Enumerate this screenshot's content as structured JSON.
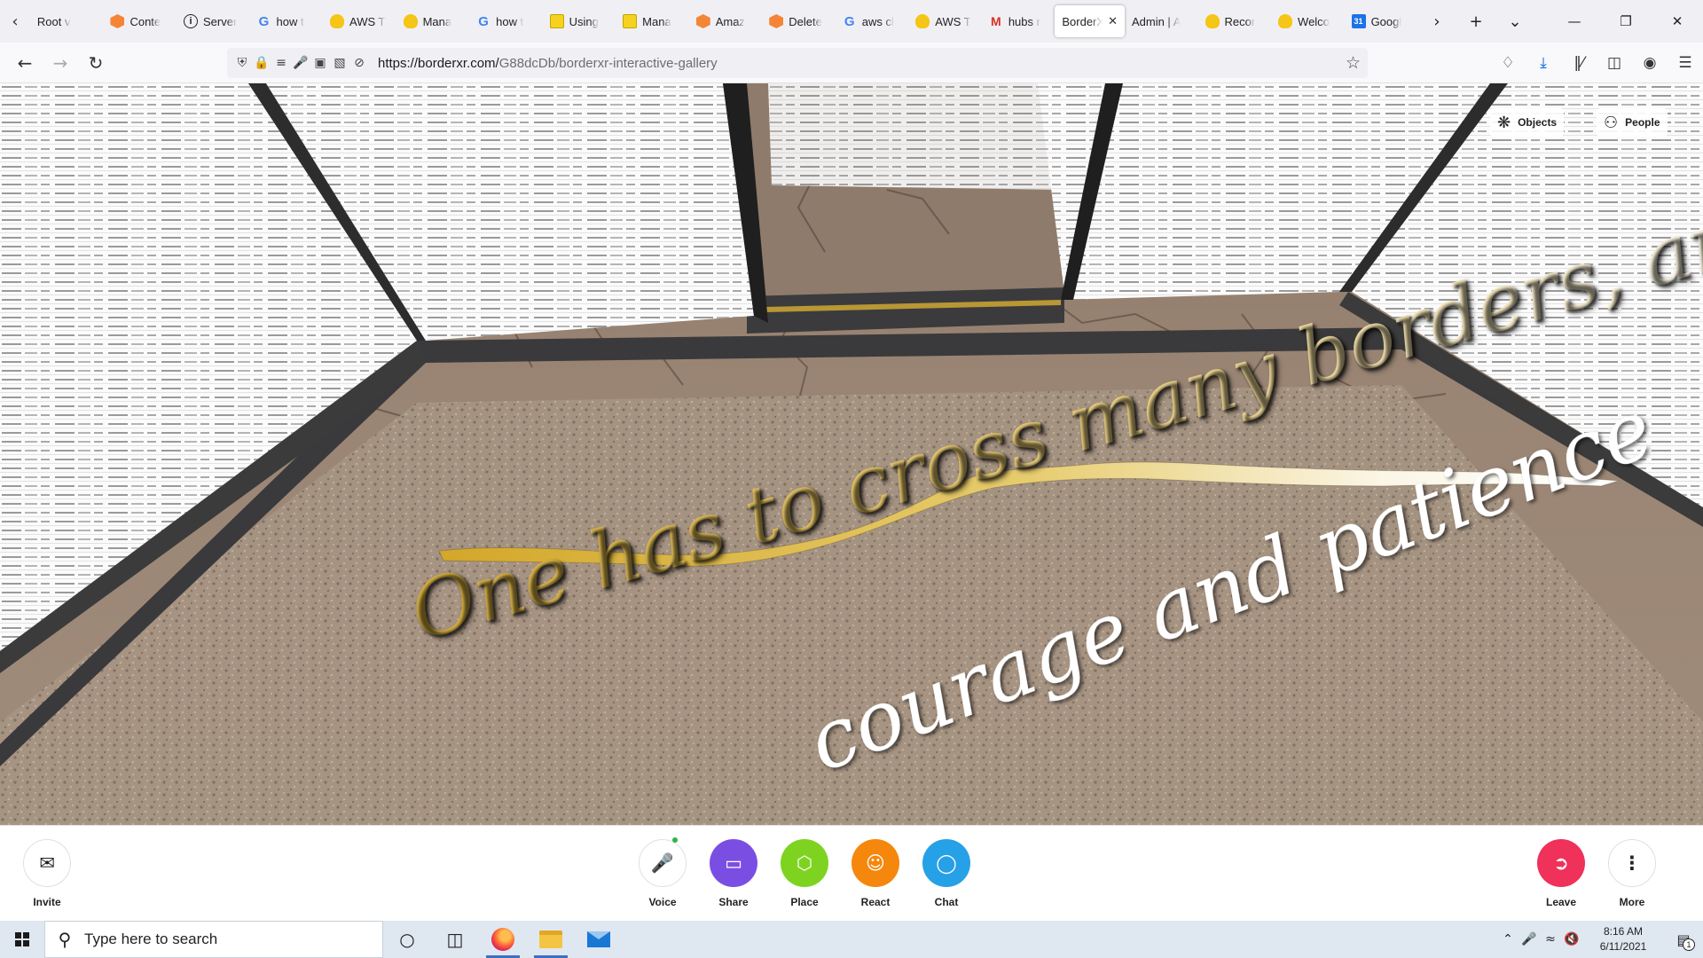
{
  "browser": {
    "tabs": [
      {
        "title": "Root v",
        "favicon": "none"
      },
      {
        "title": "Conte",
        "favicon": "aws-box"
      },
      {
        "title": "Server",
        "favicon": "info"
      },
      {
        "title": "how t",
        "favicon": "google"
      },
      {
        "title": "AWS T",
        "favicon": "duck"
      },
      {
        "title": "Mana",
        "favicon": "duck"
      },
      {
        "title": "how t",
        "favicon": "google"
      },
      {
        "title": "Using",
        "favicon": "doc"
      },
      {
        "title": "Mana",
        "favicon": "doc"
      },
      {
        "title": "Amaz",
        "favicon": "aws-box"
      },
      {
        "title": "Delete",
        "favicon": "aws-box"
      },
      {
        "title": "aws cl",
        "favicon": "google"
      },
      {
        "title": "AWS T",
        "favicon": "duck"
      },
      {
        "title": "hubs r",
        "favicon": "gmail"
      },
      {
        "title": "BorderX",
        "favicon": "none",
        "active": true
      },
      {
        "title": "Admin | A",
        "favicon": "none"
      },
      {
        "title": "Recor",
        "favicon": "duck"
      },
      {
        "title": "Welco",
        "favicon": "duck"
      },
      {
        "title": "Googl",
        "favicon": "calendar"
      }
    ],
    "url_host": "https://borderxr.com/",
    "url_path": "G88dcDb/borderxr-interactive-gallery"
  },
  "scene": {
    "quote_line1": "One has to cross many borders, and it takes",
    "quote_line2": "courage and patience",
    "objects_label": "Objects",
    "people_label": "People"
  },
  "toolbar": {
    "invite": "Invite",
    "voice": "Voice",
    "share": "Share",
    "place": "Place",
    "react": "React",
    "chat": "Chat",
    "leave": "Leave",
    "more": "More",
    "colors": {
      "share": "#7b4ee3",
      "place": "#7ed321",
      "react": "#f5870c",
      "chat": "#26a0e6",
      "leave": "#f0315a"
    }
  },
  "taskbar": {
    "search_placeholder": "Type here to search",
    "time": "8:16 AM",
    "date": "6/11/2021",
    "notification_count": "1"
  }
}
